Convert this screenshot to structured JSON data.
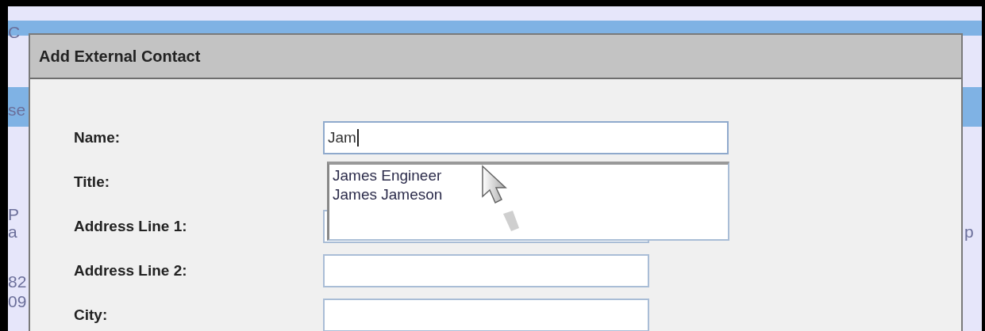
{
  "left_fragments": [
    "C",
    "se",
    "P",
    "a",
    "82",
    "09"
  ],
  "right_fragments": [
    "p"
  ],
  "dialog": {
    "title": "Add External Contact",
    "fields": [
      {
        "label": "Name:",
        "kind": "wide",
        "value": "Jam",
        "focused": true
      },
      {
        "label": "Title:",
        "kind": "covered"
      },
      {
        "label": "Address Line 1:",
        "kind": "normal",
        "focused": false
      },
      {
        "label": "Address Line 2:",
        "kind": "normal",
        "focused": false
      },
      {
        "label": "City:",
        "kind": "normal",
        "focused": false
      }
    ],
    "suggestions": [
      "James Engineer",
      "James Jameson"
    ]
  }
}
